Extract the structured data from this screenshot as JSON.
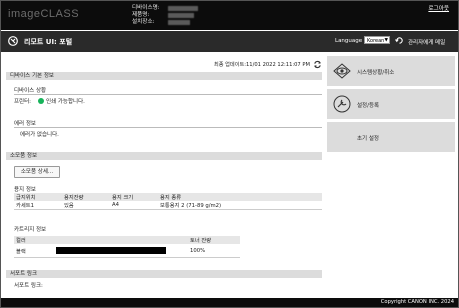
{
  "header": {
    "brand": "imageCLASS",
    "device_name_label": "디바이스명:",
    "product_name_label": "제품명:",
    "location_label": "설치장소:",
    "logout": "로그아웃"
  },
  "titlebar": {
    "title": "리모트 UI: 포털",
    "language_label": "Language",
    "language_value": "Korean",
    "admin_link": "관리자에게 메일"
  },
  "status": {
    "last_update": "최종 업데이트:11/01 2022 12:11:07 PM"
  },
  "device_basic_info": {
    "title": "디바이스 기본 정보",
    "device_status_title": "디바이스 상황",
    "printer_label": "프린터:",
    "printer_status": "인쇄 가능합니다.",
    "error_title": "에러 정보",
    "error_text": "에러가 없습니다."
  },
  "consumables": {
    "title": "소모품 정보",
    "detail_button": "소모품 상세...",
    "paper_title": "용지 정보",
    "paper_headers": [
      "급지위치",
      "용지잔량",
      "용지 크기",
      "용지 종류"
    ],
    "paper_rows": [
      [
        "카세트1",
        "있음",
        "A4",
        "보통용지 2 (71-89 g/m2)"
      ]
    ],
    "cartridge_title": "카트리지 정보",
    "cartridge_headers": [
      "컬러",
      "",
      "토너 잔량"
    ],
    "cartridge_rows": [
      {
        "color": "블랙",
        "level_percent": 100,
        "level_text": "100%"
      }
    ]
  },
  "support": {
    "title": "서포트 링크",
    "link_label": "서포트 링크:"
  },
  "sidebar": {
    "items": [
      {
        "label": "시스템상황/취소",
        "icon": "eye-icon"
      },
      {
        "label": "설정/등록",
        "icon": "settings-icon"
      },
      {
        "label": "초기 설정",
        "icon": ""
      }
    ]
  },
  "footer": {
    "copyright": "Copyright CANON INC. 2024"
  },
  "colors": {
    "topbar": "#0c0c0c",
    "titlebar": "#2a2a2a",
    "section": "#dcdcdc",
    "ready_dot": "#17b35a"
  }
}
